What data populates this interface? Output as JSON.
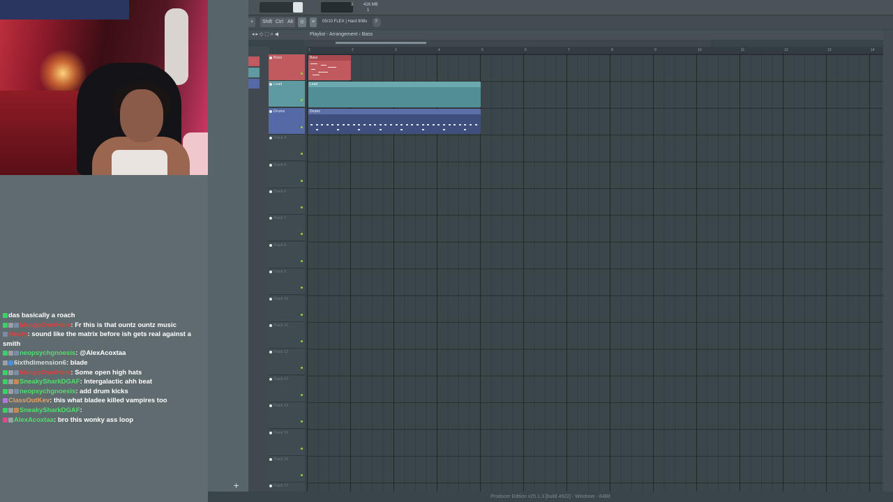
{
  "fl_toolbar": {
    "cpu_mem": "416 MB",
    "cpu_value": "3",
    "cpu_value2": "1",
    "shift_label": "Shift",
    "ctrl_label": "Ctrl",
    "alt_label": "Alt",
    "preset": "05/10 FLEX | Hard 808s"
  },
  "playlist": {
    "breadcrumb": "Playlist - Arrangement › Bass",
    "bar_numbers": [
      "1",
      "2",
      "3",
      "4",
      "5",
      "6",
      "7",
      "8",
      "9",
      "10",
      "11",
      "12",
      "13",
      "14"
    ],
    "tracks": [
      {
        "name": "Bass",
        "color": "#c05a5e"
      },
      {
        "name": "Lead",
        "color": "#5e9aa0"
      },
      {
        "name": "Drums",
        "color": "#5569a6"
      },
      {
        "name": "Track 4",
        "color": ""
      },
      {
        "name": "Track 5",
        "color": ""
      },
      {
        "name": "Track 6",
        "color": ""
      },
      {
        "name": "Track 7",
        "color": ""
      },
      {
        "name": "Track 8",
        "color": ""
      },
      {
        "name": "Track 9",
        "color": ""
      },
      {
        "name": "Track 10",
        "color": ""
      },
      {
        "name": "Track 11",
        "color": ""
      },
      {
        "name": "Track 12",
        "color": ""
      },
      {
        "name": "Track 13",
        "color": ""
      },
      {
        "name": "Track 14",
        "color": ""
      },
      {
        "name": "Track 15",
        "color": ""
      },
      {
        "name": "Track 16",
        "color": ""
      },
      {
        "name": "Track 17",
        "color": ""
      }
    ],
    "clips": [
      {
        "track": 0,
        "label": "Bass",
        "start_bar": 1,
        "length_bars": 1,
        "color": "#c05a5e",
        "head": "#a84a4f"
      },
      {
        "track": 1,
        "label": "Lead",
        "start_bar": 1,
        "length_bars": 4,
        "color": "#4f8f95",
        "head": "#6aa9ae"
      },
      {
        "track": 2,
        "label": "Drums",
        "start_bar": 1,
        "length_bars": 4,
        "color": "#3e4f7e",
        "head": "#5c6fa8"
      }
    ]
  },
  "status_bar": "Producer Edition v25.1.3 [build 4922] - Windows - 64Bit",
  "chat": {
    "messages": [
      {
        "user": "",
        "user_color": "#55e08a",
        "badges": [
          "#3ad06a"
        ],
        "text": "das basically a roach"
      },
      {
        "user": "MangoOverHere",
        "user_color": "#e0403a",
        "badges": [
          "#3ad06a",
          "#9aa0a6",
          "#7b8ca6"
        ],
        "text": "Fr this is that ountz ountz music"
      },
      {
        "user": "Newly",
        "user_color": "#e0403a",
        "badges": [
          "#7b8ca6"
        ],
        "text": "sound like the matrix before ish gets real against a smith"
      },
      {
        "user": "neopsychgnoesis",
        "user_color": "#4ee06a",
        "badges": [
          "#3ad06a",
          "#9aa0a6",
          "#7b8ca6"
        ],
        "text": "@AlexAcoxtaa"
      },
      {
        "user": "6ixthdimension6",
        "user_color": "#d7dde0",
        "badges": [
          "#9aa0a6",
          "#4a8ee0"
        ],
        "text": "blade"
      },
      {
        "user": "MangoOverHere",
        "user_color": "#e0403a",
        "badges": [
          "#3ad06a",
          "#9aa0a6",
          "#7b8ca6"
        ],
        "text": "Some open high hats"
      },
      {
        "user": "SneakySharkDGAF",
        "user_color": "#4ee06a",
        "badges": [
          "#3ad06a",
          "#9aa0a6",
          "#c08a5a"
        ],
        "text": "Intergalactic ahh beat"
      },
      {
        "user": "neopsychgnoesis",
        "user_color": "#4ee06a",
        "badges": [
          "#3ad06a",
          "#9aa0a6",
          "#7b8ca6"
        ],
        "text": "add drum kicks"
      },
      {
        "user": "ClassOutKev",
        "user_color": "#e8a060",
        "badges": [
          "#b07ad8"
        ],
        "text": "this what bladee killed vampires too"
      },
      {
        "user": "SneakySharkDGAF",
        "user_color": "#4ee06a",
        "badges": [
          "#3ad06a",
          "#9aa0a6",
          "#c08a5a"
        ],
        "text": ""
      },
      {
        "user": "AlexAcoxtaa",
        "user_color": "#4ee06a",
        "badges": [
          "#e04a8a",
          "#9aa0a6"
        ],
        "text": "bro this wonky ass loop"
      }
    ]
  }
}
